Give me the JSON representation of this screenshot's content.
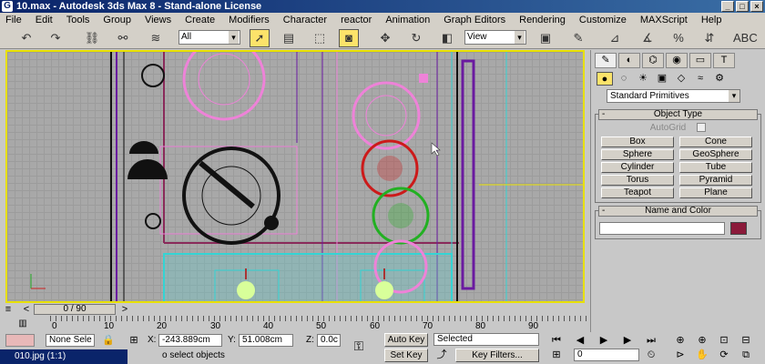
{
  "window": {
    "title": "10.max - Autodesk 3ds Max 8 - Stand-alone License",
    "app_icon": "3ds-max-icon"
  },
  "menu": [
    "File",
    "Edit",
    "Tools",
    "Group",
    "Views",
    "Create",
    "Modifiers",
    "Character",
    "reactor",
    "Animation",
    "Graph Editors",
    "Rendering",
    "Customize",
    "MAXScript",
    "Help"
  ],
  "toolbar": {
    "selection_filter": "All",
    "ref_coord": "View"
  },
  "panel": {
    "category_dropdown": "Standard Primitives",
    "object_type_title": "Object Type",
    "autogrid_label": "AutoGrid",
    "buttons": [
      "Box",
      "Cone",
      "Sphere",
      "GeoSphere",
      "Cylinder",
      "Tube",
      "Torus",
      "Pyramid",
      "Teapot",
      "Plane"
    ],
    "name_color_title": "Name and Color",
    "object_color": "#8b1a3a"
  },
  "timeline": {
    "frame_label": "0 / 90",
    "ticks": [
      "0",
      "10",
      "20",
      "30",
      "40",
      "50",
      "60",
      "70",
      "80",
      "90"
    ]
  },
  "status": {
    "selection": "None Sele",
    "x_label": "X:",
    "x_value": "-243.889cm",
    "y_label": "Y:",
    "y_value": "51.008cm",
    "z_label": "Z:",
    "z_value": "0.0c",
    "prompt": "o select objects",
    "auto_key": "Auto Key",
    "set_key": "Set Key",
    "key_mode": "Selected",
    "key_filters": "Key Filters...",
    "current_frame": "0"
  },
  "taskbar": {
    "item": "010.jpg (1:1)"
  },
  "colors": {
    "selection_yellow": "#e8e000",
    "pink": "#ee82d8",
    "red": "#cc1a1a",
    "green": "#22b022",
    "purple": "#6a1aa0",
    "cyan": "#34d4d4"
  }
}
